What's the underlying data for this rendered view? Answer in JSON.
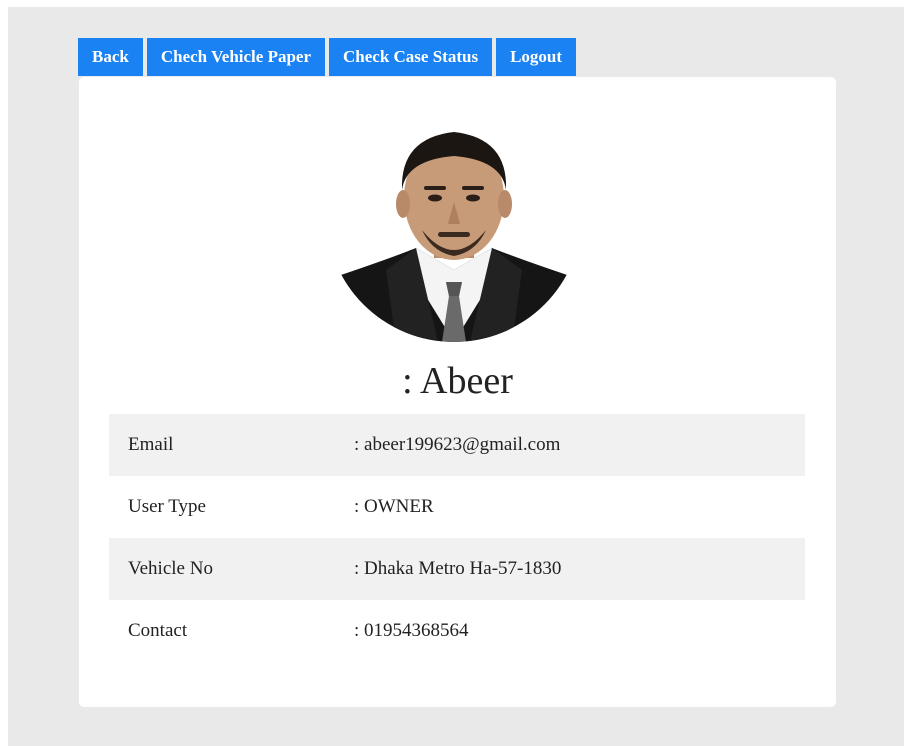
{
  "nav": {
    "back_label": "Back",
    "vehicle_paper_label": "Chech Vehicle Paper",
    "case_status_label": "Check Case Status",
    "logout_label": "Logout"
  },
  "profile": {
    "name": ": Abeer",
    "rows": [
      {
        "label": "Email",
        "value": ": abeer199623@gmail.com"
      },
      {
        "label": "User Type",
        "value": ": OWNER"
      },
      {
        "label": "Vehicle No",
        "value": ": Dhaka Metro Ha-57-1830"
      },
      {
        "label": "Contact",
        "value": ": 01954368564"
      }
    ]
  },
  "colors": {
    "nav_button": "#1a82f2",
    "page_bg": "#e9e9e9",
    "card_bg": "#ffffff",
    "row_shade": "#f1f1f1"
  }
}
